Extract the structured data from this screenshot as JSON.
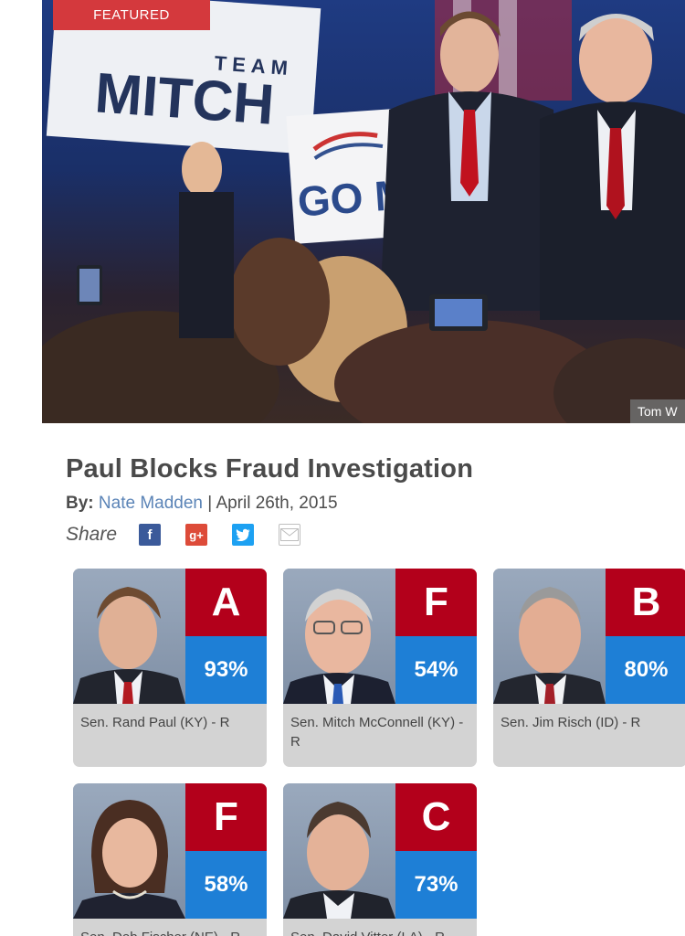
{
  "hero": {
    "badge": "FEATURED",
    "credit": "Tom W",
    "sign_team": "TEAM",
    "sign_mitch": "MITCH",
    "sign_go": "GO MI"
  },
  "article": {
    "title": "Paul Blocks Fraud Investigation",
    "by_label": "By:",
    "author": "Nate Madden",
    "separator": "|",
    "date": "April 26th, 2015",
    "share_label": "Share"
  },
  "share_icons": [
    "facebook-icon",
    "google-plus-icon",
    "twitter-icon",
    "email-icon"
  ],
  "colors": {
    "grade_red": "#b3001b",
    "percent_blue": "#1e7fd6",
    "card_gray": "#d3d3d3",
    "featured_red": "#d4393d",
    "author_link": "#5b84b7"
  },
  "senators": [
    {
      "grade": "A",
      "score": "93%",
      "name": "Sen. Rand Paul (KY) - R"
    },
    {
      "grade": "F",
      "score": "54%",
      "name": "Sen. Mitch McConnell (KY) - R"
    },
    {
      "grade": "B",
      "score": "80%",
      "name": "Sen. Jim Risch (ID) - R"
    },
    {
      "grade": "F",
      "score": "58%",
      "name": "Sen. Deb Fischer (NE) - R"
    },
    {
      "grade": "C",
      "score": "73%",
      "name": "Sen. David Vitter (LA) - R"
    }
  ]
}
